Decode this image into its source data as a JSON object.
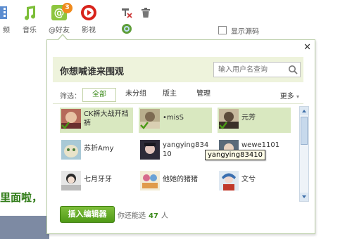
{
  "toolbar": {
    "items": [
      {
        "label": "频",
        "icon": "film-icon"
      },
      {
        "label": "音乐",
        "icon": "music-note-icon"
      },
      {
        "label": "@好友",
        "icon": "at-sign-icon",
        "badge": "3"
      },
      {
        "label": "影视",
        "icon": "play-icon"
      }
    ],
    "show_source_label": "显示源码"
  },
  "background": {
    "partial_text": "里面啦，"
  },
  "popup": {
    "title": "你想喊谁来围观",
    "search_placeholder": "输入用户名查询",
    "filter_label": "筛选：",
    "filters": [
      "全部",
      "未分组",
      "版主",
      "管理"
    ],
    "active_filter": "全部",
    "more_label": "更多",
    "friends": [
      {
        "name": "CK裤大战开裆裤",
        "selected": true
      },
      {
        "name": "•misS",
        "selected": true
      },
      {
        "name": "元芳",
        "selected": true
      },
      {
        "name": "苏折Amy",
        "selected": false
      },
      {
        "name": "yangying83410",
        "selected": false
      },
      {
        "name": "wewe1101",
        "selected": false
      },
      {
        "name": "七月牙牙",
        "selected": false
      },
      {
        "name": "他她的猪猪",
        "selected": false
      },
      {
        "name": "文兮",
        "selected": false
      }
    ],
    "tooltip": "yangying83410",
    "insert_button": "插入编辑器",
    "remain_prefix": "你还能选",
    "remain_count": "47",
    "remain_suffix": "人"
  },
  "colors": {
    "accent_green": "#3b8a1a",
    "header_bg": "#eef3dc",
    "selected_bg": "#d9e8c0",
    "badge_orange": "#f08a1c"
  }
}
